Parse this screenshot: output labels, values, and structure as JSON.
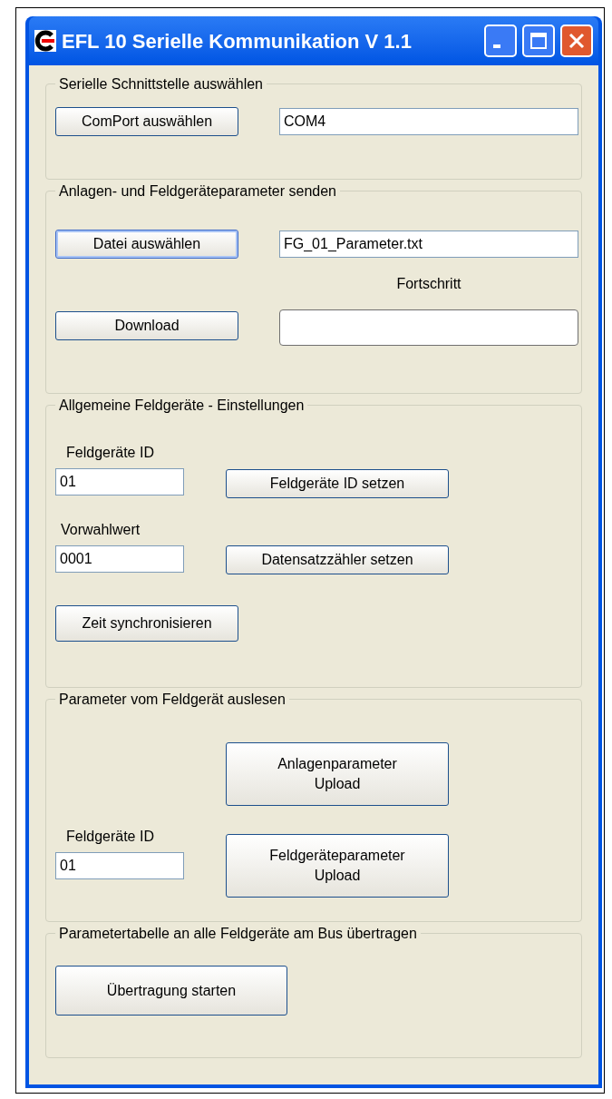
{
  "window": {
    "title": "EFL 10 Serielle Kommunikation V 1.1"
  },
  "port_group": {
    "title": "Serielle Schnittstelle auswählen",
    "button": "ComPort auswählen",
    "value": "COM4"
  },
  "send_group": {
    "title": "Anlagen- und Feldgeräteparameter senden",
    "file_button": {
      "label": "Datei auswählen",
      "focused": true
    },
    "file_value": "FG_01_Parameter.txt",
    "download_button": "Download",
    "progress_label": "Fortschritt",
    "progress": {
      "level": 0
    }
  },
  "settings_group": {
    "title": "Allgemeine Feldgeräte - Einstellungen",
    "id_label": "Feldgeräte ID",
    "id_value": "01",
    "id_button": "Feldgeräte ID setzen",
    "preset_label": "Vorwahlwert",
    "preset_value": "0001",
    "preset_button": "Datensatzzähler setzen",
    "sync_button": "Zeit synchronisieren"
  },
  "read_group": {
    "title": "Parameter vom Feldgerät auslesen",
    "plant_button": [
      "Anlagenparameter",
      "Upload"
    ],
    "id_label": "Feldgeräte ID",
    "id_value": "01",
    "device_button": [
      "Feldgeräteparameter",
      "Upload"
    ]
  },
  "broadcast_group": {
    "title": "Parametertabelle an alle Feldgeräte am Bus übertragen",
    "button": "Übertragung starten"
  }
}
